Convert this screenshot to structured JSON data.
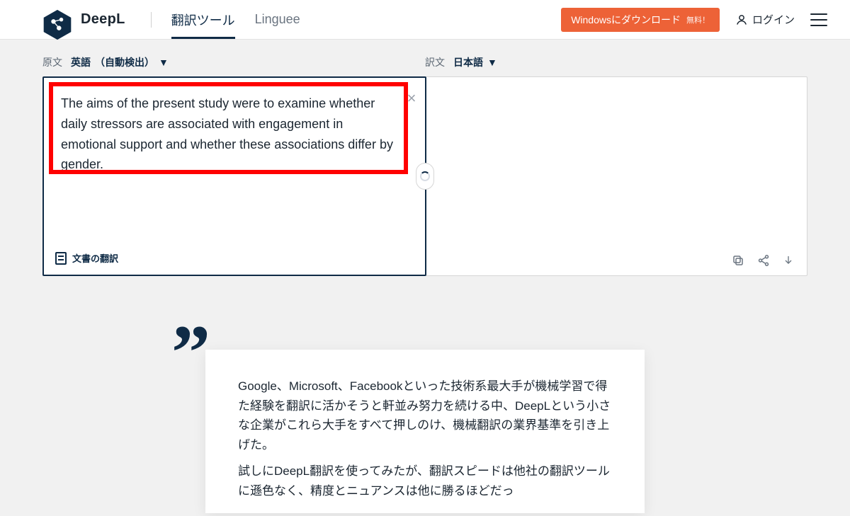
{
  "brand": {
    "name": "DeepL"
  },
  "nav": {
    "translate": "翻訳ツール",
    "linguee": "Linguee"
  },
  "header": {
    "download_cta": "Windowsにダウンロード",
    "download_badge": "無料！",
    "login": "ログイン"
  },
  "translator": {
    "source_label": "原文",
    "source_lang": "英語",
    "source_detect": "（自動検出）",
    "target_label": "訳文",
    "target_lang": "日本語",
    "source_text": "The aims of the present study were to examine whether daily stressors are associated with engagement in emotional support and whether these associations differ by gender.",
    "doc_translate_label": "文書の翻訳"
  },
  "quote": {
    "p1": "Google、Microsoft、Facebookといった技術系最大手が機械学習で得た経験を翻訳に活かそうと軒並み努力を続ける中、DeepLという小さな企業がこれら大手をすべて押しのけ、機械翻訳の業界基準を引き上げた。",
    "p2": "試しにDeepL翻訳を使ってみたが、翻訳スピードは他社の翻訳ツールに遜色なく、精度とニュアンスは他に勝るほどだっ"
  }
}
